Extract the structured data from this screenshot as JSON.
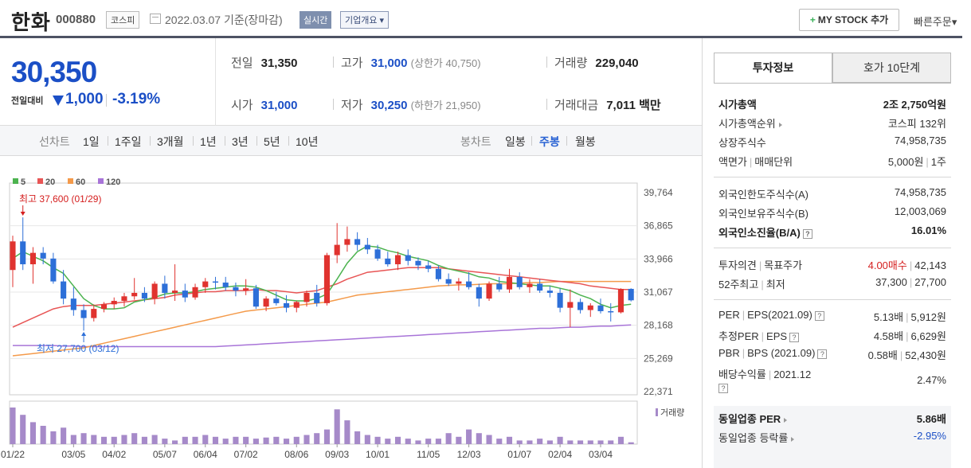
{
  "header": {
    "name": "한화",
    "code": "000880",
    "market": "코스피",
    "date_text": "2022.03.07 기준(장마감)",
    "realtime": "실시간",
    "corp_info": "기업개요",
    "mystock": "MY STOCK 추가",
    "quick_order": "빠른주문"
  },
  "price": {
    "current": "30,350",
    "prev_label": "전일대비",
    "change": "1,000",
    "change_pct": "-3.19%"
  },
  "summary": {
    "prev_label": "전일",
    "prev_value": "31,350",
    "high_label": "고가",
    "high_value": "31,000",
    "upper_limit": "(상한가 40,750)",
    "volume_label": "거래량",
    "volume_value": "229,040",
    "open_label": "시가",
    "open_value": "31,000",
    "low_label": "저가",
    "low_value": "30,250",
    "lower_limit": "(하한가 21,950)",
    "amount_label": "거래대금",
    "amount_value": "7,011",
    "amount_unit": "백만"
  },
  "period_bar": {
    "line_label": "선차트",
    "line_items": [
      "1일",
      "1주일",
      "3개월",
      "1년",
      "3년",
      "5년",
      "10년"
    ],
    "candle_label": "봉차트",
    "candle_items": [
      "일봉",
      "주봉",
      "월봉"
    ],
    "active_candle": "주봉"
  },
  "side": {
    "tabs": [
      "투자정보",
      "호가 10단계"
    ],
    "rows": {
      "mktcap_l": "시가총액",
      "mktcap_r": "2조 2,750억원",
      "rank_l": "시가총액순위",
      "rank_r": "코스피 132위",
      "listed_l": "상장주식수",
      "listed_r": "74,958,735",
      "par_l": "액면가",
      "par_l2": "매매단위",
      "par_r": "5,000원",
      "par_r2": "1주",
      "fl_limit_l": "외국인한도주식수(A)",
      "fl_limit_r": "74,958,735",
      "fl_hold_l": "외국인보유주식수(B)",
      "fl_hold_r": "12,003,069",
      "fl_ratio_l": "외국인소진율(B/A)",
      "fl_ratio_r": "16.01%",
      "opinion_l": "투자의견",
      "opinion_l2": "목표주가",
      "opinion_r": "4.00매수",
      "opinion_r2": "42,143",
      "w52_l": "52주최고",
      "w52_l2": "최저",
      "w52_r": "37,300",
      "w52_r2": "27,700",
      "per_l": "PER",
      "per_l2": "EPS(2021.09)",
      "per_r": "5.13배",
      "per_r2": "5,912원",
      "eper_l": "추정PER",
      "eper_l2": "EPS",
      "eper_r": "4.58배",
      "eper_r2": "6,629원",
      "pbr_l": "PBR",
      "pbr_l2": "BPS (2021.09)",
      "pbr_r": "0.58배",
      "pbr_r2": "52,430원",
      "div_l": "배당수익률",
      "div_l2": "2021.12",
      "div_r": "2.47%",
      "ind_per_l": "동일업종 PER",
      "ind_per_r": "5.86배",
      "ind_rate_l": "동일업종 등락률",
      "ind_rate_r": "-2.95%"
    }
  },
  "chart_data": {
    "type": "candlestick",
    "legend": [
      {
        "name": "5",
        "color": "#4cb34f"
      },
      {
        "name": "20",
        "color": "#e85555"
      },
      {
        "name": "60",
        "color": "#f49a4a"
      },
      {
        "name": "120",
        "color": "#a874d8"
      }
    ],
    "y_ticks": [
      "39,764",
      "36,865",
      "33,966",
      "31,067",
      "28,168",
      "25,269",
      "22,371"
    ],
    "ylim": [
      22371,
      39764
    ],
    "x_ticks": [
      "01/22",
      "03/05",
      "04/02",
      "05/07",
      "06/04",
      "07/02",
      "08/06",
      "09/03",
      "10/01",
      "11/05",
      "12/03",
      "01/07",
      "02/04",
      "03/04"
    ],
    "x_tick_index": [
      0,
      6,
      10,
      15,
      19,
      23,
      28,
      32,
      36,
      41,
      45,
      50,
      54,
      58
    ],
    "max_annotation": "최고 37,600 (01/29)",
    "max_index": 1,
    "min_annotation": "최저 27,700 (03/12)",
    "min_index": 7,
    "volume_label": "거래량",
    "candles": [
      [
        33000,
        36000,
        31500,
        35500
      ],
      [
        35500,
        37600,
        33000,
        33500
      ],
      [
        33500,
        35000,
        31800,
        34500
      ],
      [
        34500,
        35000,
        33500,
        34000
      ],
      [
        34000,
        34500,
        31800,
        32000
      ],
      [
        32000,
        33000,
        30000,
        30500
      ],
      [
        30500,
        31500,
        29000,
        29500
      ],
      [
        29500,
        30000,
        27700,
        28800
      ],
      [
        28800,
        30000,
        28500,
        29600
      ],
      [
        29600,
        30200,
        29300,
        30000
      ],
      [
        30000,
        30600,
        29600,
        30300
      ],
      [
        30300,
        31000,
        29800,
        30700
      ],
      [
        30700,
        32300,
        30400,
        31000
      ],
      [
        31000,
        31500,
        30200,
        30500
      ],
      [
        30500,
        32000,
        30000,
        31800
      ],
      [
        31800,
        32500,
        30500,
        31000
      ],
      [
        31000,
        33500,
        30300,
        31200
      ],
      [
        31200,
        31800,
        30200,
        30600
      ],
      [
        30600,
        31800,
        30400,
        31500
      ],
      [
        31500,
        32300,
        31000,
        32000
      ],
      [
        32000,
        32400,
        31300,
        31900
      ],
      [
        31900,
        32400,
        31200,
        31500
      ],
      [
        31500,
        31900,
        30700,
        31200
      ],
      [
        31200,
        32200,
        30800,
        31400
      ],
      [
        31400,
        31700,
        29600,
        29800
      ],
      [
        29800,
        30700,
        29400,
        30500
      ],
      [
        30500,
        31100,
        29900,
        30100
      ],
      [
        30100,
        30800,
        29300,
        29700
      ],
      [
        29700,
        30300,
        29300,
        30200
      ],
      [
        30200,
        31200,
        29800,
        31000
      ],
      [
        31000,
        31700,
        29800,
        30100
      ],
      [
        30100,
        34500,
        29900,
        34300
      ],
      [
        34300,
        37100,
        33600,
        35200
      ],
      [
        35200,
        36800,
        34600,
        35700
      ],
      [
        35700,
        36300,
        34700,
        35200
      ],
      [
        35200,
        35800,
        34400,
        34800
      ],
      [
        34800,
        35200,
        33800,
        34000
      ],
      [
        34000,
        34600,
        33300,
        33500
      ],
      [
        33500,
        34600,
        33000,
        34300
      ],
      [
        34300,
        34800,
        33400,
        33800
      ],
      [
        33800,
        34100,
        33000,
        33400
      ],
      [
        33400,
        33800,
        32800,
        33100
      ],
      [
        33100,
        33400,
        32000,
        32200
      ],
      [
        32200,
        32700,
        31600,
        31800
      ],
      [
        31800,
        32300,
        31200,
        32000
      ],
      [
        32000,
        32800,
        31300,
        31500
      ],
      [
        31500,
        31800,
        29800,
        30500
      ],
      [
        30500,
        32000,
        30300,
        31800
      ],
      [
        31800,
        32400,
        31100,
        31300
      ],
      [
        31300,
        33100,
        31000,
        32400
      ],
      [
        32400,
        32800,
        31300,
        31500
      ],
      [
        31500,
        32200,
        31000,
        31800
      ],
      [
        31800,
        32200,
        31000,
        31200
      ],
      [
        31200,
        31600,
        30600,
        31000
      ],
      [
        31000,
        31400,
        29300,
        29700
      ],
      [
        29700,
        31300,
        28000,
        30200
      ],
      [
        30200,
        30500,
        29200,
        29500
      ],
      [
        29500,
        30100,
        28900,
        29900
      ],
      [
        29900,
        30500,
        29200,
        29400
      ],
      [
        29400,
        30100,
        28500,
        29300
      ],
      [
        29300,
        31400,
        29200,
        31350
      ],
      [
        31350,
        31400,
        30250,
        30350
      ]
    ],
    "ma5": [
      34000,
      34600,
      34200,
      33800,
      33200,
      32700,
      31600,
      30500,
      29900,
      29600,
      29600,
      29700,
      30200,
      30400,
      30600,
      30900,
      31000,
      31000,
      31100,
      31300,
      31400,
      31500,
      31600,
      31600,
      31500,
      31200,
      30800,
      30400,
      30300,
      30300,
      30500,
      30900,
      32200,
      33600,
      34600,
      35100,
      35000,
      34700,
      34500,
      34200,
      34000,
      33800,
      33400,
      33100,
      32900,
      32700,
      32400,
      32300,
      32000,
      31900,
      31800,
      31700,
      31600,
      31600,
      31400,
      31200,
      30800,
      30500,
      30000,
      29700,
      29900,
      30000
    ],
    "ma20": [
      28000,
      28400,
      28800,
      29200,
      29600,
      29800,
      29900,
      29900,
      29900,
      30000,
      30100,
      30200,
      30300,
      30400,
      30500,
      30600,
      30800,
      30900,
      31000,
      31100,
      31100,
      31200,
      31200,
      31200,
      31300,
      31200,
      31200,
      31100,
      31000,
      31100,
      31200,
      31500,
      31800,
      32200,
      32500,
      32800,
      32900,
      33000,
      33100,
      33200,
      33200,
      33200,
      33200,
      33100,
      33000,
      32900,
      32800,
      32700,
      32600,
      32500,
      32400,
      32300,
      32200,
      32100,
      32000,
      31900,
      31800,
      31600,
      31500,
      31400,
      31300,
      31300
    ],
    "ma60": [
      25500,
      25600,
      25700,
      25800,
      25900,
      26000,
      26100,
      26200,
      26400,
      26600,
      26800,
      27000,
      27200,
      27400,
      27600,
      27800,
      28000,
      28200,
      28400,
      28600,
      28800,
      29000,
      29200,
      29400,
      29500,
      29600,
      29700,
      29800,
      29900,
      30000,
      30100,
      30200,
      30400,
      30600,
      30800,
      30900,
      31000,
      31100,
      31200,
      31300,
      31400,
      31500,
      31600,
      31650,
      31700,
      31700,
      31750,
      31800,
      31800,
      31800,
      31850,
      31900,
      31900,
      31950,
      32000,
      32000,
      32000,
      32000,
      32000,
      32000,
      32000,
      32000
    ],
    "ma120": [
      26400,
      26400,
      26400,
      26400,
      26400,
      26350,
      26350,
      26300,
      26300,
      26300,
      26300,
      26300,
      26300,
      26300,
      26300,
      26300,
      26300,
      26300,
      26300,
      26300,
      26300,
      26350,
      26400,
      26450,
      26500,
      26550,
      26600,
      26650,
      26700,
      26750,
      26800,
      26850,
      26900,
      26950,
      27000,
      27050,
      27100,
      27150,
      27200,
      27250,
      27300,
      27350,
      27400,
      27450,
      27500,
      27550,
      27600,
      27650,
      27700,
      27750,
      27800,
      27850,
      27900,
      27900,
      27950,
      28000,
      28000,
      28050,
      28100,
      28100,
      28150,
      28200
    ],
    "volumes": [
      1.0,
      0.8,
      0.6,
      0.5,
      0.35,
      0.45,
      0.25,
      0.3,
      0.25,
      0.2,
      0.2,
      0.25,
      0.3,
      0.2,
      0.25,
      0.15,
      0.1,
      0.2,
      0.2,
      0.25,
      0.2,
      0.15,
      0.2,
      0.2,
      0.15,
      0.18,
      0.2,
      0.15,
      0.2,
      0.25,
      0.3,
      0.4,
      0.95,
      0.65,
      0.35,
      0.25,
      0.2,
      0.15,
      0.2,
      0.15,
      0.1,
      0.15,
      0.15,
      0.3,
      0.2,
      0.4,
      0.3,
      0.25,
      0.15,
      0.2,
      0.1,
      0.1,
      0.15,
      0.1,
      0.2,
      0.1,
      0.1,
      0.1,
      0.1,
      0.1,
      0.2,
      0.05
    ]
  }
}
